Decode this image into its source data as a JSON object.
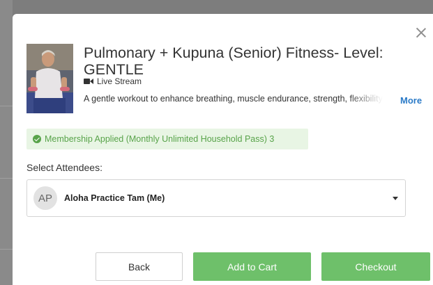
{
  "modal": {
    "title": "Pulmonary + Kupuna (Senior) Fitness- Level: GENTLE",
    "stream_type": "Live Stream",
    "description": "A gentle workout to enhance breathing, muscle endurance, strength, flexibility and balance.",
    "more_label": "More",
    "membership_text": "Membership Applied (Monthly Unlimited Household Pass) 3",
    "attendees_label": "Select Attendees:",
    "attendee": {
      "initials": "AP",
      "name": "Aloha Practice Tam (Me)"
    },
    "buttons": {
      "back": "Back",
      "add_to_cart": "Add to Cart",
      "checkout": "Checkout"
    }
  },
  "colors": {
    "accent_green": "#6ec06a",
    "badge_bg": "#e8f5e4",
    "badge_text": "#58a34a",
    "link_blue": "#2a7ac7"
  },
  "icons": [
    "close-icon",
    "video-camera-icon",
    "check-circle-icon",
    "caret-down-icon"
  ]
}
